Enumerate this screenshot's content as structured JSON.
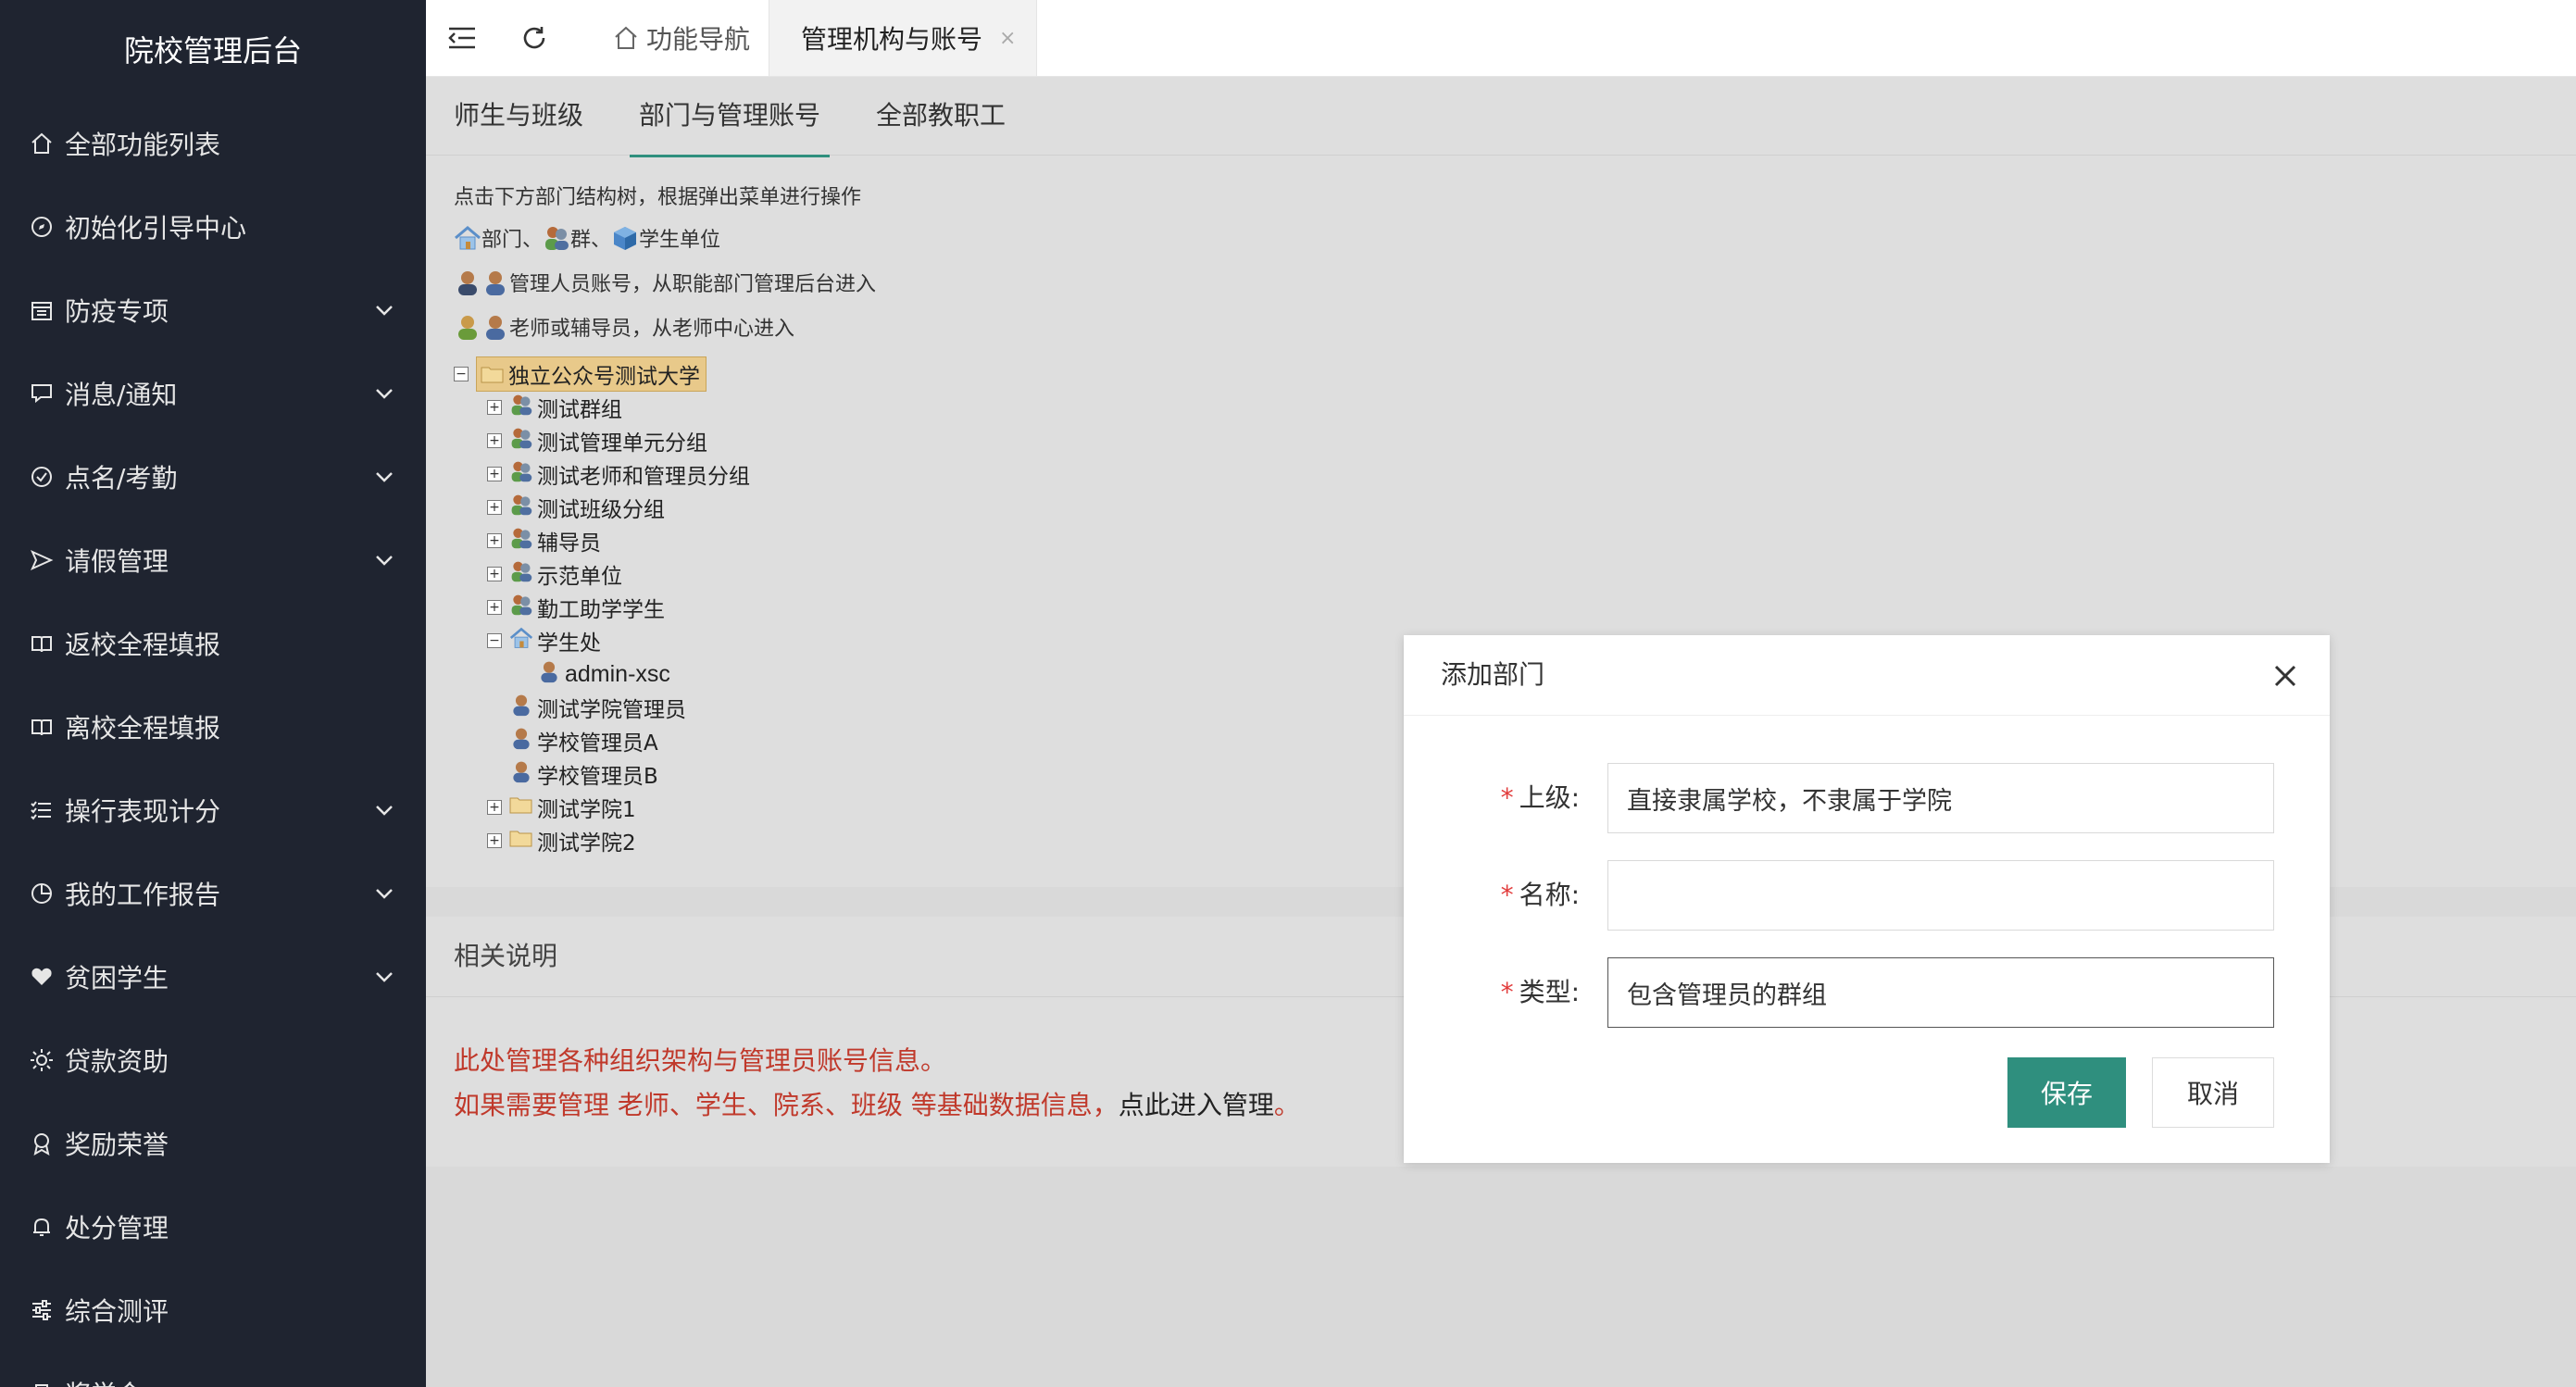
{
  "sidebar": {
    "title": "院校管理后台",
    "items": [
      {
        "label": "全部功能列表",
        "icon": "home-icon",
        "has_children": false
      },
      {
        "label": "初始化引导中心",
        "icon": "compass-icon",
        "has_children": false
      },
      {
        "label": "防疫专项",
        "icon": "calendar-icon",
        "has_children": true
      },
      {
        "label": "消息/通知",
        "icon": "chat-icon",
        "has_children": true
      },
      {
        "label": "点名/考勤",
        "icon": "check-circle-icon",
        "has_children": true
      },
      {
        "label": "请假管理",
        "icon": "send-icon",
        "has_children": true
      },
      {
        "label": "返校全程填报",
        "icon": "book-icon",
        "has_children": false
      },
      {
        "label": "离校全程填报",
        "icon": "book-icon",
        "has_children": false
      },
      {
        "label": "操行表现计分",
        "icon": "list-icon",
        "has_children": true
      },
      {
        "label": "我的工作报告",
        "icon": "pie-chart-icon",
        "has_children": true
      },
      {
        "label": "贫困学生",
        "icon": "heart-icon",
        "has_children": true
      },
      {
        "label": "贷款资助",
        "icon": "sun-icon",
        "has_children": false
      },
      {
        "label": "奖励荣誉",
        "icon": "award-icon",
        "has_children": false
      },
      {
        "label": "处分管理",
        "icon": "bell-icon",
        "has_children": false
      },
      {
        "label": "综合测评",
        "icon": "sliders-icon",
        "has_children": false
      },
      {
        "label": "奖学金",
        "icon": "trophy-icon",
        "has_children": false
      }
    ]
  },
  "topbar": {
    "tabs": [
      {
        "label": "功能导航",
        "icon": "home-icon",
        "active": false
      },
      {
        "label": "管理机构与账号",
        "active": true
      }
    ]
  },
  "subtabs": [
    "师生与班级",
    "部门与管理账号",
    "全部教职工"
  ],
  "help": {
    "line1": "点击下方部门结构树，根据弹出菜单进行操作",
    "line2_parts": [
      "部门、",
      "群、",
      "学生单位"
    ],
    "line3": "管理人员账号，从职能部门管理后台进入",
    "line4": "老师或辅导员，从老师中心进入"
  },
  "tree": {
    "root": "独立公众号测试大学",
    "nodes": [
      {
        "label": "测试群组",
        "type": "group",
        "toggle": "+",
        "level": 1
      },
      {
        "label": "测试管理单元分组",
        "type": "group",
        "toggle": "+",
        "level": 1
      },
      {
        "label": "测试老师和管理员分组",
        "type": "group",
        "toggle": "+",
        "level": 1
      },
      {
        "label": "测试班级分组",
        "type": "group",
        "toggle": "+",
        "level": 1
      },
      {
        "label": "辅导员",
        "type": "group",
        "toggle": "+",
        "level": 1
      },
      {
        "label": "示范单位",
        "type": "group",
        "toggle": "+",
        "level": 1
      },
      {
        "label": "勤工助学学生",
        "type": "group",
        "toggle": "+",
        "level": 1
      },
      {
        "label": "学生处",
        "type": "dept",
        "toggle": "-",
        "level": 1
      },
      {
        "label": "admin-xsc",
        "type": "admin",
        "toggle": "",
        "level": 2
      },
      {
        "label": "测试学院管理员",
        "type": "admin",
        "toggle": "",
        "level": 1
      },
      {
        "label": "学校管理员A",
        "type": "admin",
        "toggle": "",
        "level": 1
      },
      {
        "label": "学校管理员B",
        "type": "admin",
        "toggle": "",
        "level": 1
      },
      {
        "label": "测试学院1",
        "type": "folder",
        "toggle": "+",
        "level": 1
      },
      {
        "label": "测试学院2",
        "type": "folder",
        "toggle": "+",
        "level": 1
      }
    ]
  },
  "notes": {
    "title": "相关说明",
    "line1": "此处管理各种组织架构与管理员账号信息。",
    "line2_red": "如果需要管理 老师、学生、院系、班级 等基础数据信息，",
    "line2_link": "点此进入管理",
    "line2_end": "。"
  },
  "modal": {
    "title": "添加部门",
    "fields": [
      {
        "label": "上级:",
        "value": "直接隶属学校，不隶属于学院",
        "placeholder": ""
      },
      {
        "label": "名称:",
        "value": "",
        "placeholder": ""
      },
      {
        "label": "类型:",
        "value": "包含管理员的群组",
        "placeholder": ""
      }
    ],
    "save_label": "保存",
    "cancel_label": "取消"
  },
  "colors": {
    "sidebar_bg": "#1f2430",
    "accent": "#2f8f7e",
    "required": "#e23c3c",
    "note_red": "#c0392b"
  }
}
